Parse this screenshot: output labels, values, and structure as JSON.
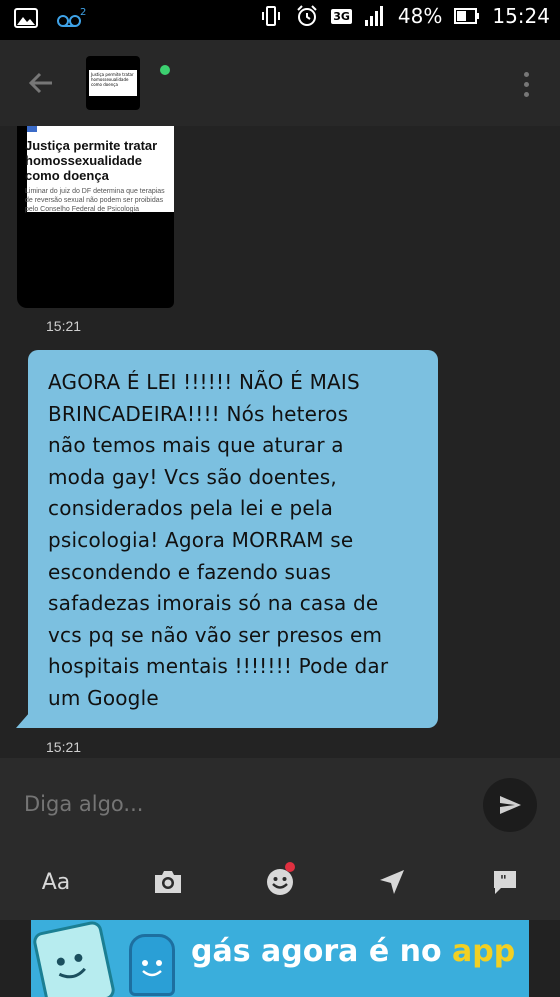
{
  "status_bar": {
    "battery": "48%",
    "time": "15:24",
    "network": "3G",
    "voicemail_count": "2"
  },
  "toolbar": {
    "thumbnail_title": "Justiça permite tratar homossexualidade como doença"
  },
  "messages": {
    "received_image": {
      "article_title": "Justiça permite tratar homossexualidade como doença",
      "article_subtitle": "Liminar do juiz do DF determina que terapias de reversão sexual não podem ser proibidas pelo Conselho Federal de Psicologia",
      "time": "15:21"
    },
    "received_text": {
      "text": "AGORA É LEI !!!!!! NÃO É MAIS\nBRINCADEIRA!!!! Nós heteros\nnão temos mais que aturar a\nmoda gay! Vcs são doentes,\nconsiderados pela lei e pela\npsicologia! Agora MORRAM se\nescondendo e fazendo suas\nsafadezas imorais só na casa de\nvcs pq se não vão ser presos em\nhospitais mentais !!!!!!! Pode dar\num Google",
      "time": "15:21"
    }
  },
  "composer": {
    "placeholder": "Diga algo...",
    "format_label": "Aa"
  },
  "banner": {
    "text_main": "gás agora é no ",
    "text_accent": "app"
  },
  "colors": {
    "bubble": "#7cc0e0",
    "background": "#232323",
    "online": "#3cd070",
    "banner": "#3aaedc",
    "banner_accent": "#f2d023"
  }
}
